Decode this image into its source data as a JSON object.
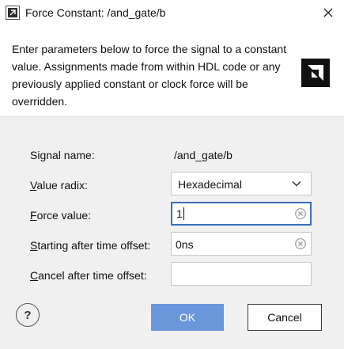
{
  "window": {
    "title": "Force Constant:  /and_gate/b",
    "app_icon": "app-icon",
    "close_icon": "close-icon"
  },
  "description": {
    "text": "Enter parameters below to force the signal to a constant value. Assignments made from within HDL code or any previously applied constant or clock force will be overridden.",
    "logo": "amd-logo"
  },
  "form": {
    "signal_name": {
      "label": "Signal name:",
      "value": "/and_gate/b"
    },
    "value_radix": {
      "label_ul": "V",
      "label_rest": "alue radix:",
      "selected": "Hexadecimal",
      "icon": "chevron-down-icon"
    },
    "force_value": {
      "label_ul": "F",
      "label_rest": "orce value:",
      "value": "1",
      "focused": true
    },
    "starting_after": {
      "label_ul": "S",
      "label_rest": "tarting after time offset:",
      "value": "0ns"
    },
    "cancel_after": {
      "label_ul": "C",
      "label_rest": "ancel after time offset:",
      "value": ""
    }
  },
  "buttons": {
    "help_label": "?",
    "ok_label": "OK",
    "cancel_label": "Cancel"
  },
  "colors": {
    "ok_button": "#6a96dc",
    "focus_border": "#3a6fb8",
    "background": "#f0f0f0"
  }
}
